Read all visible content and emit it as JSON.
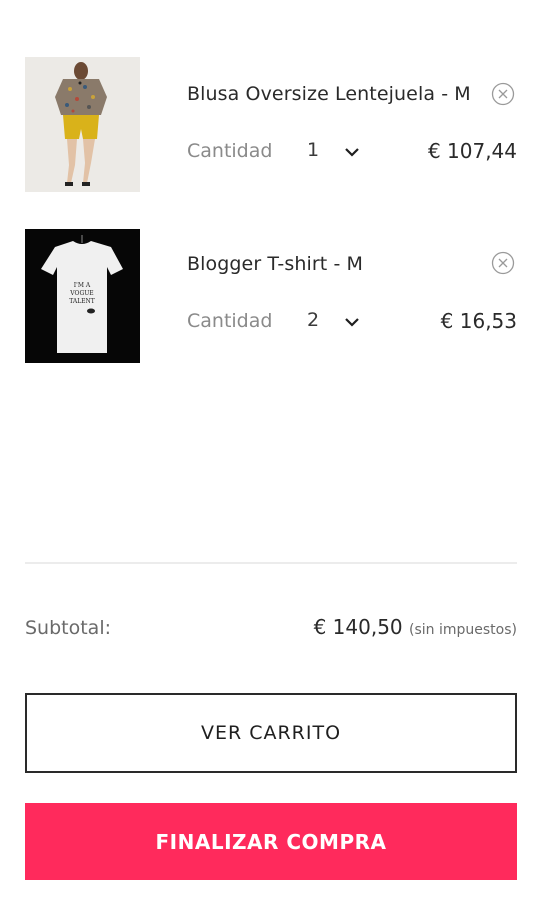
{
  "cart": {
    "items": [
      {
        "name": "Blusa Oversize Lentejuela - M",
        "quantity_label": "Cantidad",
        "quantity": "1",
        "price": "€ 107,44",
        "image_icon": "blouse-photo"
      },
      {
        "name": "Blogger T-shirt - M",
        "quantity_label": "Cantidad",
        "quantity": "2",
        "price": "€ 16,53",
        "image_icon": "tshirt-photo"
      }
    ]
  },
  "summary": {
    "subtotal_label": "Subtotal:",
    "subtotal_value": "€ 140,50",
    "subtotal_note": "(sin impuestos)"
  },
  "actions": {
    "view_cart_label": "VER CARRITO",
    "checkout_label": "FINALIZAR COMPRA"
  },
  "colors": {
    "accent": "#ff2a5c",
    "text": "#2a2a2a",
    "muted": "#8a8a8a"
  }
}
